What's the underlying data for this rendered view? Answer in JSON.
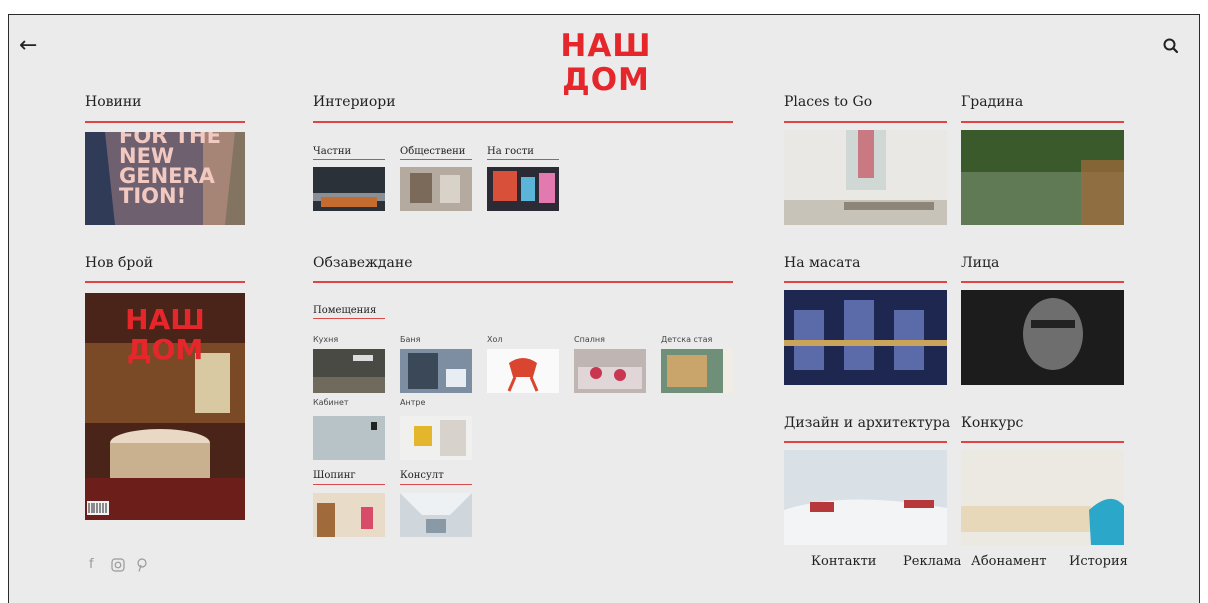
{
  "header": {
    "back_icon": "arrow-left-icon",
    "logo": "НАШ ДОМ",
    "search_icon": "search-icon"
  },
  "colors": {
    "accent": "#e5262b",
    "background": "#ebebeb"
  },
  "col1": {
    "news_title": "Новини",
    "news_cover": [
      "FOR THE",
      "NEW",
      "GENERA",
      "TION!"
    ],
    "issue_title": "Нов брой",
    "issue_logo": "НАШ ДОМ"
  },
  "interiors": {
    "title": "Интериори",
    "items": [
      {
        "label": "Частни"
      },
      {
        "label": "Обществени"
      },
      {
        "label": "На гости"
      }
    ]
  },
  "furnishing": {
    "title": "Обзавеждане",
    "rooms_label": "Помещения",
    "rooms": [
      {
        "label": "Кухня"
      },
      {
        "label": "Баня"
      },
      {
        "label": "Хол"
      },
      {
        "label": "Спалня"
      },
      {
        "label": "Детска стая"
      },
      {
        "label": "Кабинет"
      },
      {
        "label": "Антре"
      }
    ],
    "shopping_label": "Шопинг",
    "consult_label": "Консулт"
  },
  "right": {
    "places": "Places to Go",
    "garden": "Градина",
    "table": "На масата",
    "faces": "Лица",
    "design": "Дизайн и архитектура",
    "contest": "Конкурс"
  },
  "footer": {
    "links": [
      "Контакти",
      "Реклама",
      "Абонамент",
      "История"
    ]
  },
  "social": [
    "facebook-icon",
    "instagram-icon",
    "pinterest-icon"
  ]
}
